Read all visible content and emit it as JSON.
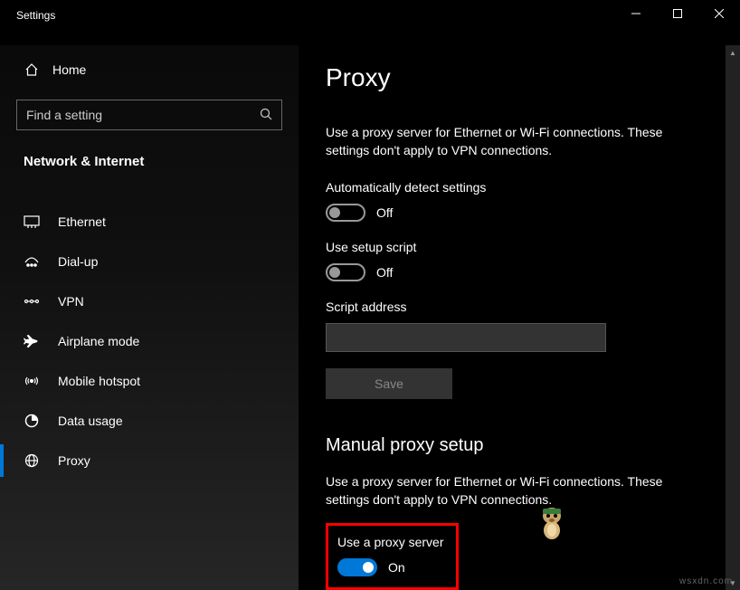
{
  "window": {
    "title": "Settings"
  },
  "sidebar": {
    "home_label": "Home",
    "search_placeholder": "Find a setting",
    "section_heading": "Network & Internet",
    "items": [
      {
        "label": "Ethernet",
        "icon": "ethernet-icon",
        "selected": false
      },
      {
        "label": "Dial-up",
        "icon": "dialup-icon",
        "selected": false
      },
      {
        "label": "VPN",
        "icon": "vpn-icon",
        "selected": false
      },
      {
        "label": "Airplane mode",
        "icon": "airplane-icon",
        "selected": false
      },
      {
        "label": "Mobile hotspot",
        "icon": "hotspot-icon",
        "selected": false
      },
      {
        "label": "Data usage",
        "icon": "data-usage-icon",
        "selected": false
      },
      {
        "label": "Proxy",
        "icon": "globe-icon",
        "selected": true
      }
    ]
  },
  "content": {
    "page_title": "Proxy",
    "intro": "Use a proxy server for Ethernet or Wi-Fi connections. These settings don't apply to VPN connections.",
    "auto_detect": {
      "label": "Automatically detect settings",
      "state_text": "Off",
      "on": false
    },
    "setup_script": {
      "label": "Use setup script",
      "state_text": "Off",
      "on": false
    },
    "script_address": {
      "label": "Script address",
      "value": ""
    },
    "save_label": "Save",
    "manual_heading": "Manual proxy setup",
    "manual_intro": "Use a proxy server for Ethernet or Wi-Fi connections. These settings don't apply to VPN connections.",
    "use_proxy": {
      "label": "Use a proxy server",
      "state_text": "On",
      "on": true
    }
  },
  "watermark": "wsxdn.com"
}
